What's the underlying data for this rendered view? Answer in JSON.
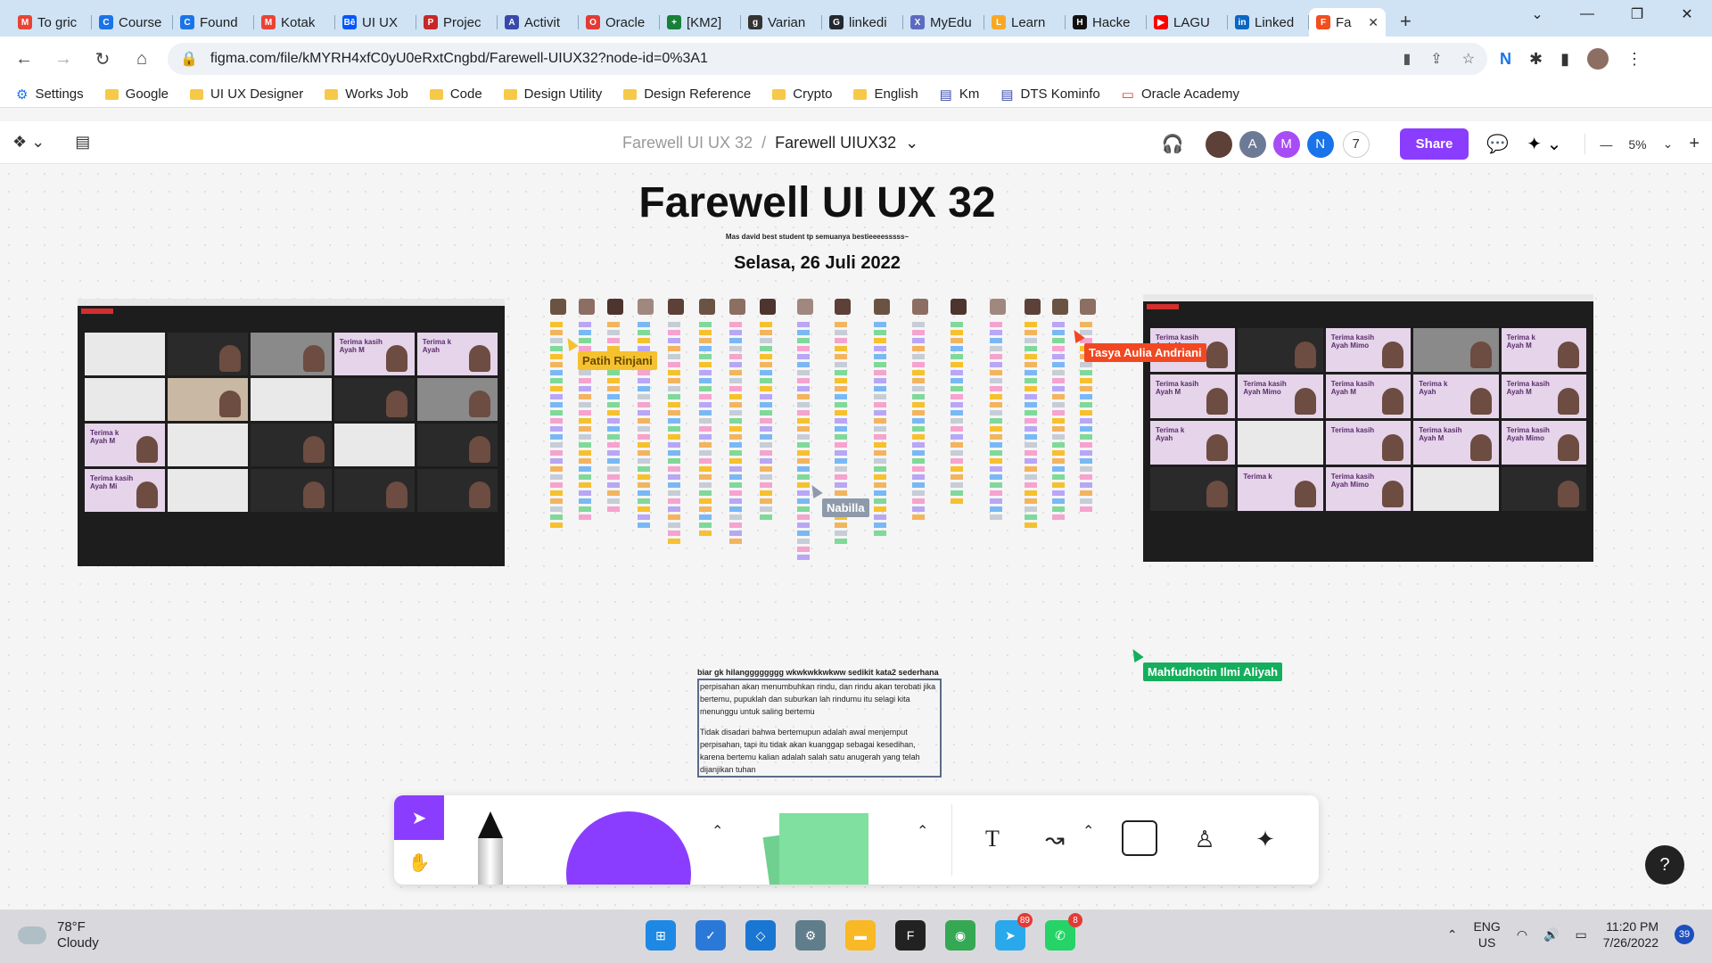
{
  "browser": {
    "tabs": [
      {
        "label": "To gric",
        "fav": "M",
        "color": "#ea4335"
      },
      {
        "label": "Course",
        "fav": "C",
        "color": "#1a73e8"
      },
      {
        "label": "Found",
        "fav": "C",
        "color": "#1a73e8"
      },
      {
        "label": "Kotak",
        "fav": "M",
        "color": "#ea4335"
      },
      {
        "label": "UI UX",
        "fav": "Bē",
        "color": "#0057ff"
      },
      {
        "label": "Projec",
        "fav": "P",
        "color": "#c62828"
      },
      {
        "label": "Activit",
        "fav": "A",
        "color": "#3949ab"
      },
      {
        "label": "Oracle",
        "fav": "O",
        "color": "#e53935"
      },
      {
        "label": "[KM2]",
        "fav": "+",
        "color": "#188038"
      },
      {
        "label": "Varian",
        "fav": "g",
        "color": "#333333"
      },
      {
        "label": "linkedi",
        "fav": "G",
        "color": "#24292f"
      },
      {
        "label": "MyEdu",
        "fav": "X",
        "color": "#5c6bc0"
      },
      {
        "label": "Learn",
        "fav": "L",
        "color": "#f9a825"
      },
      {
        "label": "Hacke",
        "fav": "H",
        "color": "#111111"
      },
      {
        "label": "LAGU",
        "fav": "▶",
        "color": "#ff0000"
      },
      {
        "label": "Linked",
        "fav": "in",
        "color": "#0a66c2"
      },
      {
        "label": "Fa",
        "fav": "F",
        "color": "#f24e1e",
        "active": true
      }
    ],
    "new_tab": "+",
    "url": "figma.com/file/kMYRH4xfC0yU0eRxtCngbd/Farewell-UIUX32?node-id=0%3A1",
    "bookmarks": [
      {
        "label": "Settings",
        "type": "gear"
      },
      {
        "label": "Google",
        "type": "folder"
      },
      {
        "label": "UI UX Designer",
        "type": "folder"
      },
      {
        "label": "Works Job",
        "type": "folder"
      },
      {
        "label": "Code",
        "type": "folder"
      },
      {
        "label": "Design Utility",
        "type": "folder"
      },
      {
        "label": "Design Reference",
        "type": "folder"
      },
      {
        "label": "Crypto",
        "type": "folder"
      },
      {
        "label": "English",
        "type": "folder"
      },
      {
        "label": "Km",
        "type": "site"
      },
      {
        "label": "DTS Kominfo",
        "type": "site"
      },
      {
        "label": "Oracle Academy",
        "type": "oracle"
      }
    ]
  },
  "figma": {
    "project": "Farewell UI UX 32",
    "separator": "/",
    "file": "Farewell UIUX32",
    "avatars": [
      {
        "letter": "",
        "color": "#5d4037"
      },
      {
        "letter": "A",
        "color": "#6c7a96"
      },
      {
        "letter": "M",
        "color": "#a84cf5"
      },
      {
        "letter": "N",
        "color": "#1a73e8"
      }
    ],
    "more_count": "7",
    "share_label": "Share",
    "zoom_level": "5%",
    "accent": "#8b3dff"
  },
  "board": {
    "title": "Farewell UI UX 32",
    "subtitle": "Mas david best student tp semuanya bestieeeesssss~",
    "date": "Selasa, 26 Juli 2022",
    "left_tiles": [
      {
        "cls": "paper"
      },
      {
        "cls": "dark2"
      },
      {
        "cls": "grey"
      },
      {
        "cls": "lav",
        "text": "Terima kasih\nAyah M"
      },
      {
        "cls": "lav",
        "text": "Terima k\nAyah"
      },
      {
        "cls": "paper"
      },
      {
        "cls": "bright"
      },
      {
        "cls": "paper"
      },
      {
        "cls": "dark2"
      },
      {
        "cls": "grey"
      },
      {
        "cls": "lav",
        "text": "Terima k\nAyah M"
      },
      {
        "cls": "paper"
      },
      {
        "cls": "dark2"
      },
      {
        "cls": "paper"
      },
      {
        "cls": "dark2"
      },
      {
        "cls": "lav",
        "text": "Terima kasih\nAyah Mi"
      },
      {
        "cls": "paper"
      },
      {
        "cls": "dark2"
      },
      {
        "cls": "dark2"
      },
      {
        "cls": "dark2"
      }
    ],
    "right_tiles": [
      {
        "cls": "lav",
        "text": "Terima kasih\nAyah M"
      },
      {
        "cls": "dark2"
      },
      {
        "cls": "lav",
        "text": "Terima kasih\nAyah Mimo"
      },
      {
        "cls": "grey"
      },
      {
        "cls": "lav",
        "text": "Terima k\nAyah M"
      },
      {
        "cls": "lav",
        "text": "Terima kasih\nAyah M"
      },
      {
        "cls": "lav",
        "text": "Terima kasih\nAyah Mimo"
      },
      {
        "cls": "lav",
        "text": "Terima kasih\nAyah M"
      },
      {
        "cls": "lav",
        "text": "Terima k\nAyah"
      },
      {
        "cls": "lav",
        "text": "Terima kasih\nAyah M"
      },
      {
        "cls": "lav",
        "text": "Terima k\nAyah"
      },
      {
        "cls": "paper"
      },
      {
        "cls": "lav",
        "text": "Terima kasih"
      },
      {
        "cls": "lav",
        "text": "Terima kasih\nAyah M"
      },
      {
        "cls": "lav",
        "text": "Terima kasih\nAyah Mimo"
      },
      {
        "cls": "dark2"
      },
      {
        "cls": "lav",
        "text": "Terima k"
      },
      {
        "cls": "lav",
        "text": "Terima kasih\nAyah Mimo"
      },
      {
        "cls": "paper"
      },
      {
        "cls": "dark2"
      }
    ],
    "cursors": [
      {
        "name": "Patih Rinjani",
        "color": "#f5c12e",
        "text_color": "#6b4b00"
      },
      {
        "name": "Tasya Aulia Andriani",
        "color": "#f24822",
        "text_color": "#ffffff"
      },
      {
        "name": "Nabilla",
        "color": "#8e9aaa",
        "text_color": "#ffffff"
      },
      {
        "name": "Mahfudhotin Ilmi Aliyah",
        "color": "#14ae5c",
        "text_color": "#ffffff"
      }
    ],
    "note": {
      "heading": "biar gk hilangggggggg wkwkwkkwkww sedikit kata2 sederhana",
      "para1": "perpisahan akan menumbuhkan rindu, dan rindu akan terobati jika bertemu, pupuklah dan suburkan lah rindumu itu selagi kita menunggu untuk saling bertemu",
      "para2": "Tidak disadari bahwa bertemupun adalah awal menjemput perpisahan, tapi itu tidak akan kuanggap sebagai kesedihan, karena bertemu kalian adalah salah satu anugerah yang telah dijanjikan tuhan"
    }
  },
  "sticky_colors": [
    "#f5c12e",
    "#7fd99a",
    "#7ab8f5",
    "#b9a6f5",
    "#f5a3cf",
    "#c7cdd6",
    "#f3b45e"
  ],
  "taskbar": {
    "temp": "78°F",
    "weather": "Cloudy",
    "lang1": "ENG",
    "lang2": "US",
    "time": "11:20 PM",
    "date": "7/26/2022",
    "notif_count": "39",
    "telegram_badge": "89",
    "whatsapp_badge": "8"
  }
}
